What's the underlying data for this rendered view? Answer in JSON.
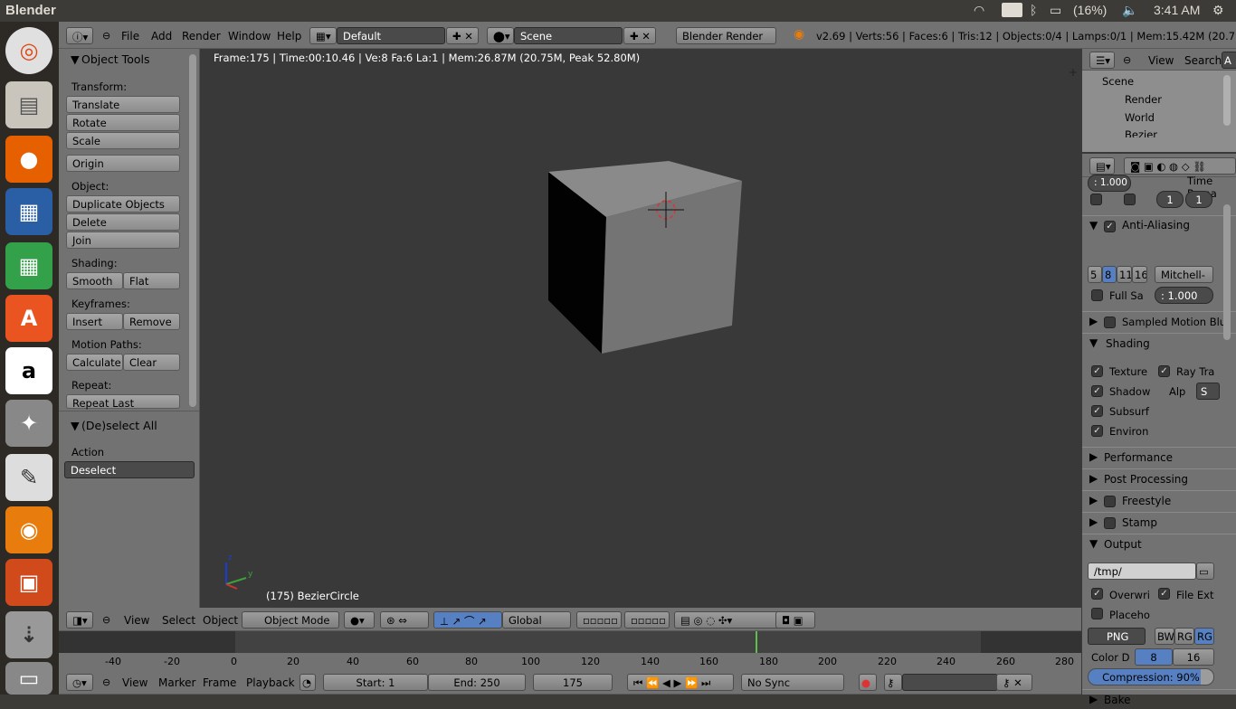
{
  "topbar": {
    "title": "Blender",
    "lang": "En",
    "battery": "(16%)",
    "time": "3:41 AM"
  },
  "launcher": {
    "items": [
      "ubuntu-icon",
      "files-icon",
      "firefox-icon",
      "writer-icon",
      "calc-icon",
      "software-center-icon",
      "amazon-icon",
      "settings-icon",
      "text-editor-icon",
      "blender-icon",
      "impress-icon",
      "usb-icon",
      "trash-icon"
    ]
  },
  "info_header": {
    "menus": [
      "File",
      "Add",
      "Render",
      "Window",
      "Help"
    ],
    "layout": "Default",
    "scene": "Scene",
    "engine": "Blender Render",
    "stats": "v2.69 | Verts:56 | Faces:6 | Tris:12 | Objects:0/4 | Lamps:0/1 | Mem:15.42M (20.75M) | Bezie"
  },
  "tool_shelf": {
    "title": "Object Tools",
    "transform_label": "Transform:",
    "translate": "Translate",
    "rotate": "Rotate",
    "scale": "Scale",
    "origin": "Origin",
    "object_label": "Object:",
    "duplicate": "Duplicate Objects",
    "delete": "Delete",
    "join": "Join",
    "shading_label": "Shading:",
    "smooth": "Smooth",
    "flat": "Flat",
    "keyframes_label": "Keyframes:",
    "insert": "Insert",
    "remove": "Remove",
    "motion_label": "Motion Paths:",
    "calculate": "Calculate",
    "clear": "Clear",
    "repeat_label": "Repeat:",
    "repeat_last": "Repeat Last",
    "operator_title": "(De)select All",
    "action_label": "Action",
    "action_value": "Deselect"
  },
  "viewport": {
    "overlay": "Frame:175 | Time:00:10.46 | Ve:8 Fa:6 La:1 | Mem:26.87M (20.75M, Peak 52.80M)",
    "object_name": "(175) BezierCircle",
    "axis_z": "z",
    "axis_y": "y"
  },
  "view3d_header": {
    "menus": [
      "View",
      "Select",
      "Object"
    ],
    "mode": "Object Mode",
    "orientation": "Global"
  },
  "timeline": {
    "ticks": [
      "-40",
      "-20",
      "0",
      "20",
      "40",
      "60",
      "80",
      "100",
      "120",
      "140",
      "160",
      "180",
      "200",
      "220",
      "240",
      "260",
      "280"
    ],
    "current_frame": 175,
    "menus": [
      "View",
      "Marker",
      "Frame",
      "Playback"
    ],
    "start": "Start: 1",
    "end": "End: 250",
    "frame": "175",
    "sync": "No Sync"
  },
  "outliner": {
    "menus": [
      "View",
      "Search"
    ],
    "items": [
      "Scene",
      "Render",
      "World",
      "Bezier"
    ],
    "all_btn": "A"
  },
  "properties": {
    "aa_value": ": 1.000",
    "time_rema": "Time Rema",
    "s1": "1",
    "s2": "1",
    "anti_aliasing": "Anti-Aliasing",
    "samples": [
      "5",
      "8",
      "11",
      "16"
    ],
    "filter": "Mitchell-",
    "full_sa": "Full Sa",
    "full_val": ": 1.000",
    "sampled_motion": "Sampled Motion Blu",
    "shading": "Shading",
    "texture": "Texture",
    "ray_tra": "Ray Tra",
    "shadow": "Shadow",
    "alp": "Alp",
    "alp_val": "S",
    "subsurf": "Subsurf",
    "environ": "Environ",
    "performance": "Performance",
    "post_processing": "Post Processing",
    "freestyle": "Freestyle",
    "stamp": "Stamp",
    "output": "Output",
    "path": "/tmp/",
    "overwri": "Overwri",
    "file_ext": "File Ext",
    "placeho": "Placeho",
    "format": "PNG",
    "bw": "BW",
    "rgb": "RGB",
    "rgba": "RGB",
    "color_d": "Color D",
    "depth8": "8",
    "depth16": "16",
    "compression": "Compression: 90%",
    "bake": "Bake"
  }
}
